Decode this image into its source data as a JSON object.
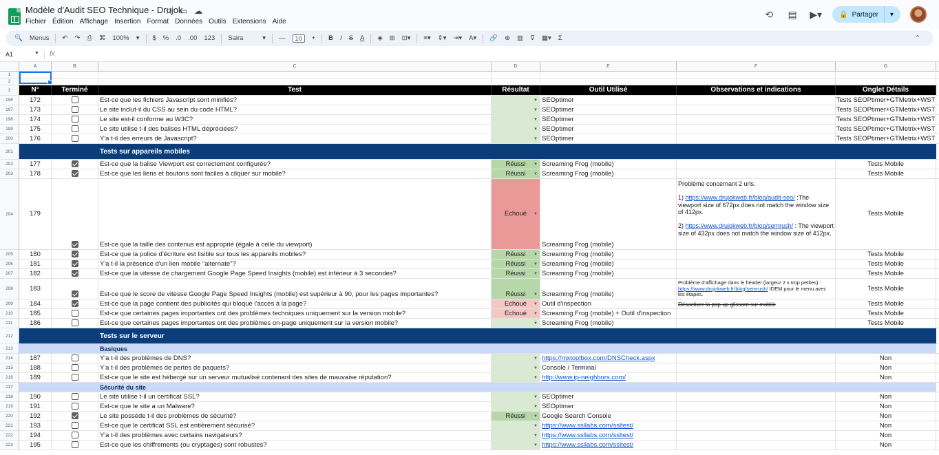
{
  "app": {
    "title": "Modèle d'Audit SEO Technique - Drujok",
    "menu": [
      "Fichier",
      "Édition",
      "Affichage",
      "Insertion",
      "Format",
      "Données",
      "Outils",
      "Extensions",
      "Aide"
    ],
    "share_label": "Partager",
    "icons": [
      "history-icon",
      "comment-icon",
      "video-call-icon"
    ]
  },
  "toolbar": {
    "search_label": "Menus",
    "zoom": "100%",
    "currency": "$",
    "percent": "%",
    "dec_less": ".0",
    "dec_more": ".00",
    "number_format": "123",
    "font": "Saira",
    "font_size": "10",
    "minus": "—",
    "plus": "+"
  },
  "formula": {
    "cell_ref": "A1",
    "fx": "fx"
  },
  "columns": [
    "A",
    "B",
    "C",
    "D",
    "E",
    "F",
    "G"
  ],
  "header": {
    "num": "N°",
    "done": "Terminé",
    "test": "Test",
    "result": "Résultat",
    "tool": "Outil Utilisé",
    "obs": "Observations et indications",
    "tab": "Onglet Détails"
  },
  "rows": [
    {
      "n": "1",
      "kind": "empty"
    },
    {
      "n": "2",
      "kind": "empty"
    },
    {
      "n": "3",
      "kind": "header"
    },
    {
      "n": "196",
      "id": "172",
      "done": false,
      "test": "Est-ce que les fichiers Javascript sont minifiés?",
      "result": "",
      "rc": "green",
      "tool": "SEOptimer",
      "obs": "",
      "tab": "Tests SEOPtimer+GTMetrix+WST"
    },
    {
      "n": "197",
      "id": "173",
      "done": false,
      "test": "Le site inclut-il du CSS au sein du code HTML?",
      "result": "",
      "rc": "green",
      "tool": "SEOptimer",
      "obs": "",
      "tab": "Tests SEOPtimer+GTMetrix+WST"
    },
    {
      "n": "198",
      "id": "174",
      "done": false,
      "test": "Le site est-il conforme au W3C?",
      "result": "",
      "rc": "green",
      "tool": "SEOptimer",
      "obs": "",
      "tab": "Tests SEOPtimer+GTMetrix+WST"
    },
    {
      "n": "199",
      "id": "175",
      "done": false,
      "test": "Le site utilise t-il des balises HTML dépréciées?",
      "result": "",
      "rc": "green",
      "tool": "SEOptimer",
      "obs": "",
      "tab": "Tests SEOPtimer+GTMetrix+WST"
    },
    {
      "n": "200",
      "id": "176",
      "done": false,
      "test": "Y'a t-il des erreurs de Javascript?",
      "result": "",
      "rc": "green",
      "tool": "SEOptimer",
      "obs": "",
      "tab": "Tests SEOPtimer+GTMetrix+WST"
    },
    {
      "n": "201",
      "kind": "section",
      "label": "Tests sur appareils mobiles"
    },
    {
      "n": "202",
      "id": "177",
      "done": true,
      "test": "Est-ce que la balise Viewport est correctement configurée?",
      "result": "Réussi",
      "rc": "green2",
      "tool": "Screaming Frog (mobile)",
      "obs": "",
      "tab": "Tests Mobile"
    },
    {
      "n": "203",
      "id": "178",
      "done": true,
      "test": "Est-ce que les liens et boutons sont faciles à cliquer sur mobile?",
      "result": "Réussi",
      "rc": "green2",
      "tool": "Screaming Frog (mobile)",
      "obs": "",
      "tab": "Tests Mobile"
    },
    {
      "n": "204",
      "id": "179",
      "done": true,
      "test": "Est-ce que la taille des contenus est approprié (égale à celle du viewport)",
      "result": "Echoué",
      "rc": "red",
      "tool": "Screaming Frog (mobile)",
      "kind": "tall",
      "tab": "Tests Mobile",
      "obs_lines": {
        "l1": "Problème concernant 2 urls.",
        "l2a": "1) ",
        "l2link": "https://www.drujokweb.fr/blog/audit-seo/",
        "l2b": " :The viewport size of 672px does not match the window size of 412px.",
        "l3a": "2) ",
        "l3link": "https://www.drujokweb.fr/blog/semrush/",
        "l3b": " : The viewport size of 432px does not match the window size of 412px."
      }
    },
    {
      "n": "205",
      "id": "180",
      "done": true,
      "test": "Est-ce que la police d'écriture est lisible sur tous les appareils mobiles?",
      "result": "Réussi",
      "rc": "green2",
      "tool": "Screaming Frog (mobile)",
      "obs": "",
      "tab": "Tests Mobile"
    },
    {
      "n": "206",
      "id": "181",
      "done": true,
      "test": "Y'a t-il la présence d'un lien mobile \"alternate\"?",
      "result": "Réussi",
      "rc": "green2",
      "tool": "Screaming Frog (mobile)",
      "obs": "",
      "tab": "Tests Mobile"
    },
    {
      "n": "207",
      "id": "182",
      "done": true,
      "test": "Est-ce que la vitesse de chargement Google Page Speed Insights (mobile) est inférieur à 3 secondes?",
      "result": "Réussi",
      "rc": "green2",
      "tool": "Screaming Frog (mobile)",
      "obs": "",
      "tab": "Tests Mobile"
    },
    {
      "n": "208",
      "id": "183",
      "done": true,
      "test": "Est-ce que le score de vitesse Google Page Speed Insights (mobile) est supérieur à 90, pour les pages importantes?",
      "result": "Réussi",
      "rc": "green2",
      "tool": "Screaming Frog (mobile)",
      "kind": "mid",
      "tab": "Tests Mobile",
      "obs_lines": {
        "l1": "Problème d'affichage dans le header (largeur 2 x trop petites) : ",
        "l1link": "https://www.drujokweb.fr/blog/semrush/",
        "l1b": " IDEM pour le menu avec les étapes."
      }
    },
    {
      "n": "209",
      "id": "184",
      "done": true,
      "test": "Est-ce que la page contient des publicités qui bloque l'accès à la page?",
      "result": "Echoué",
      "rc": "pink",
      "tool": "Outil d'inspection",
      "obs": "Désactiver la pop-up glissant sur mobile",
      "strike": true,
      "tab": "Tests Mobile"
    },
    {
      "n": "210",
      "id": "185",
      "done": false,
      "test": "Est-ce que certaines pages importantes ont des problèmes techniques uniquement sur la version mobile?",
      "result": "Echoué",
      "rc": "pink",
      "tool": "Screaming Frog (mobile) + Outil d'inspection",
      "obs": "",
      "tab": "Tests Mobile"
    },
    {
      "n": "211",
      "id": "186",
      "done": false,
      "test": "Est-ce que certaines pages importantes ont des problèmes on-page uniquement sur la version mobile?",
      "result": "",
      "rc": "green",
      "tool": "Screaming Frog (mobile)",
      "obs": "",
      "tab": "Tests Mobile"
    },
    {
      "n": "212",
      "kind": "section",
      "label": "Tests sur le serveur"
    },
    {
      "n": "213",
      "kind": "sub",
      "label": "Basiques"
    },
    {
      "n": "214",
      "id": "187",
      "done": false,
      "test": "Y'a t-il des problèmes de DNS?",
      "result": "",
      "rc": "green",
      "tool": "https://mxtoolbox.com/DNSCheck.aspx",
      "tl": true,
      "obs": "",
      "tab": "Non"
    },
    {
      "n": "215",
      "id": "188",
      "done": false,
      "test": "Y'a t-il des problèmes de pertes de paquets?",
      "result": "",
      "rc": "green",
      "tool": "Console / Terminal",
      "obs": "",
      "tab": "Non"
    },
    {
      "n": "216",
      "id": "189",
      "done": false,
      "test": "Est-ce que le site est hébergé sur un serveur mutualisé contenant des sites de mauvaise réputation?",
      "result": "",
      "rc": "green",
      "tool": "http://www.ip-neighbors.com/",
      "tl": true,
      "obs": "",
      "tab": "Non"
    },
    {
      "n": "217",
      "kind": "sub",
      "label": "Sécurité du site"
    },
    {
      "n": "218",
      "id": "190",
      "done": false,
      "test": "Le site utilise t-il un certificat SSL?",
      "result": "",
      "rc": "green",
      "tool": "SEOptimer",
      "obs": "",
      "tab": "Non"
    },
    {
      "n": "219",
      "id": "191",
      "done": false,
      "test": "Est-ce que le site a un Malware?",
      "result": "",
      "rc": "green",
      "tool": "SEOptimer",
      "obs": "",
      "tab": "Non"
    },
    {
      "n": "220",
      "id": "192",
      "done": true,
      "test": "Le site possède t-il des problèmes de sécurité?",
      "result": "Réussi",
      "rc": "green2",
      "tool": "Google Search Console",
      "obs": "",
      "tab": "Non"
    },
    {
      "n": "221",
      "id": "193",
      "done": false,
      "test": "Est-ce que le certificat SSL est entièrement sécurisé?",
      "result": "",
      "rc": "green",
      "tool": "https://www.ssllabs.com/ssltest/",
      "tl": true,
      "obs": "",
      "tab": "Non"
    },
    {
      "n": "222",
      "id": "194",
      "done": false,
      "test": "Y'a t-il des problèmes avec certains navigateurs?",
      "result": "",
      "rc": "green",
      "tool": "https://www.ssllabs.com/ssltest/",
      "tl": true,
      "obs": "",
      "tab": "Non"
    },
    {
      "n": "223",
      "id": "195",
      "done": false,
      "test": "Est-ce que les chiffrements (ou cryptages) sont robustes?",
      "result": "",
      "rc": "green",
      "tool": "https://www.ssllabs.com/ssltest/",
      "tl": true,
      "obs": "",
      "tab": "Non"
    }
  ]
}
